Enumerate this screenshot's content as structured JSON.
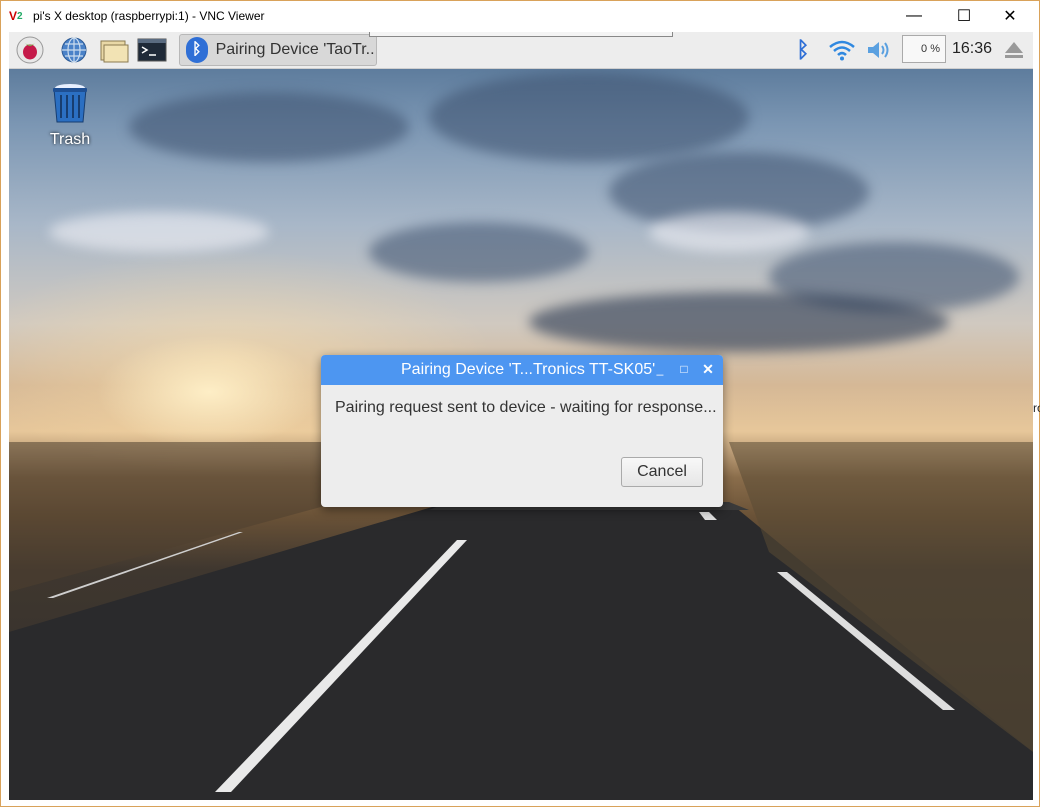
{
  "window": {
    "title": "pi's X desktop (raspberrypi:1) - VNC Viewer",
    "logo_text": "V2"
  },
  "window_controls": {
    "minimize": "—",
    "maximize": "☐",
    "close": "✕"
  },
  "taskbar": {
    "launchers": [
      "raspberry-menu-icon",
      "web-browser-icon",
      "file-manager-icon",
      "terminal-icon"
    ],
    "active_task_label": "Pairing Device 'TaoTr...",
    "cpu_usage": "0 %",
    "clock": "16:36",
    "tray_icons": [
      "bluetooth-icon",
      "wifi-icon",
      "volume-icon",
      "eject-icon"
    ]
  },
  "desktop": {
    "trash_label": "Trash"
  },
  "dialog": {
    "title": "Pairing Device 'T...Tronics TT-SK05'",
    "message": "Pairing request sent to device - waiting for response...",
    "cancel_label": "Cancel",
    "min_glyph": "_",
    "max_glyph": "□",
    "close_glyph": "✕"
  },
  "right_edge_fragment": "ro",
  "colors": {
    "dialog_titlebar": "#4d96f1",
    "bluetooth_blue": "#2f6fd6",
    "panel_bg": "#ededed"
  }
}
